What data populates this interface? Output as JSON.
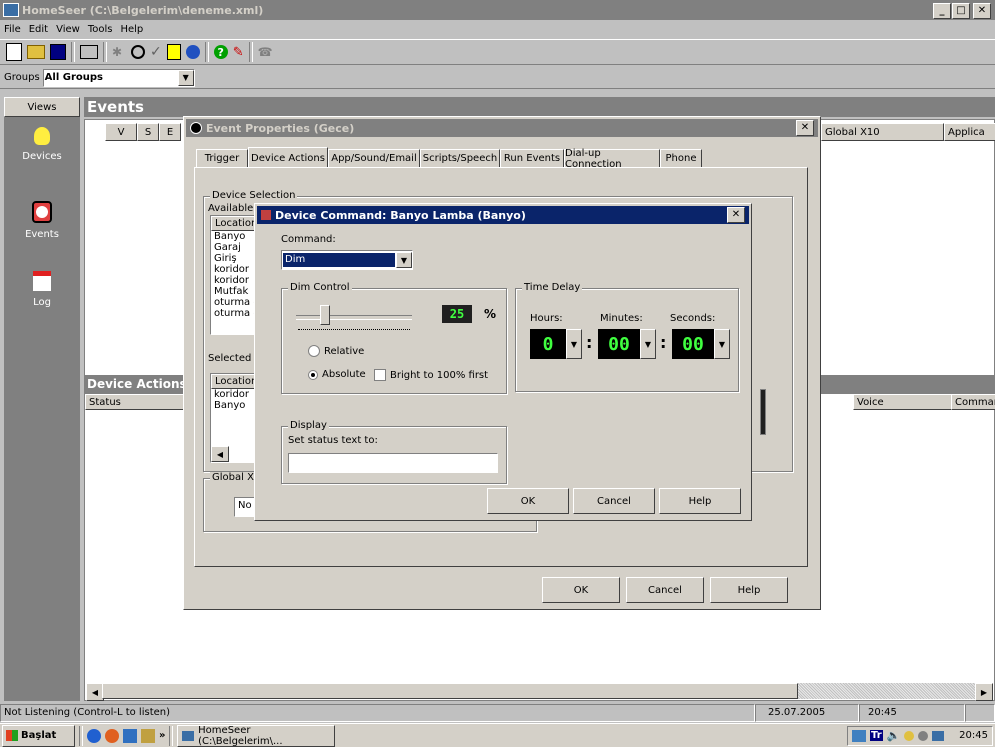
{
  "app": {
    "title": "HomeSeer (C:\\Belgelerim\\deneme.xml)",
    "menu": [
      "File",
      "Edit",
      "View",
      "Tools",
      "Help"
    ],
    "groups_label": "Groups",
    "groups_value": "All Groups"
  },
  "views": {
    "header": "Views",
    "items": [
      {
        "label": "Devices",
        "icon": "lightbulb-icon"
      },
      {
        "label": "Events",
        "icon": "clock-icon"
      },
      {
        "label": "Log",
        "icon": "log-book-icon"
      }
    ]
  },
  "events": {
    "title": "Events",
    "columns": [
      "V",
      "S",
      "E"
    ],
    "right_columns": [
      "Global X10",
      "Applica"
    ],
    "device_actions_title": "Device Actions f",
    "device_actions_columns": [
      "Status",
      "Voice",
      "Commar"
    ]
  },
  "event_props": {
    "title": "Event Properties (Gece)",
    "tabs": [
      "Trigger",
      "Device Actions",
      "App/Sound/Email",
      "Scripts/Speech",
      "Run Events",
      "Dial-up Connection",
      "Phone"
    ],
    "device_selection": "Device Selection",
    "available": "Available",
    "location_header": "Location",
    "available_list": [
      "Banyo",
      "Garaj",
      "Giriş",
      "koridor",
      "koridor",
      "Mutfak",
      "oturma o",
      "oturma o"
    ],
    "selected": "Selected",
    "selected_list": [
      "koridor",
      "Banyo"
    ],
    "global_x10": "Global X1",
    "global_value": "No",
    "ok": "OK",
    "cancel": "Cancel",
    "help": "Help"
  },
  "device_cmd": {
    "title": "Device Command: Banyo Lamba (Banyo)",
    "command_label": "Command:",
    "command_value": "Dim",
    "dim_control": "Dim Control",
    "dim_value": "25",
    "percent": "%",
    "relative": "Relative",
    "absolute": "Absolute",
    "bright_first": "Bright to 100% first",
    "time_delay": "Time Delay",
    "hours_label": "Hours:",
    "minutes_label": "Minutes:",
    "seconds_label": "Seconds:",
    "hours": "0",
    "minutes": "00",
    "seconds": "00",
    "display": "Display",
    "status_text_label": "Set status text to:",
    "status_text_value": "",
    "ok": "OK",
    "cancel": "Cancel",
    "help": "Help"
  },
  "statusbar": {
    "status": "Not Listening (Control-L to listen)",
    "date": "25.07.2005",
    "time": "20:45"
  },
  "taskbar": {
    "start": "Başlat",
    "task": "HomeSeer (C:\\Belgelerim\\...",
    "lang": "Tr",
    "clock": "20:45"
  }
}
